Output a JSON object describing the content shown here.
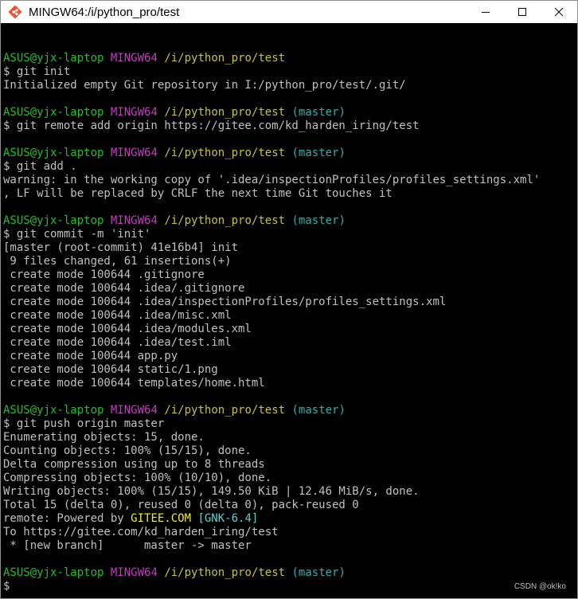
{
  "window": {
    "title": "MINGW64:/i/python_pro/test",
    "controls": [
      "minimize",
      "maximize",
      "close"
    ]
  },
  "prompt": {
    "user": "ASUS@yjx-laptop",
    "host": "MINGW64",
    "path": "/i/python_pro/test",
    "branch": "(master)"
  },
  "blocks": [
    {
      "has_branch": false,
      "command": "$ git init",
      "output": [
        "Initialized empty Git repository in I:/python_pro/test/.git/"
      ]
    },
    {
      "has_branch": true,
      "command": "$ git remote add origin https://gitee.com/kd_harden_iring/test",
      "output": []
    },
    {
      "has_branch": true,
      "command": "$ git add .",
      "output": [
        "warning: in the working copy of '.idea/inspectionProfiles/profiles_settings.xml'",
        ", LF will be replaced by CRLF the next time Git touches it"
      ]
    },
    {
      "has_branch": true,
      "command": "$ git commit -m 'init'",
      "output": [
        "[master (root-commit) 41e16b4] init",
        " 9 files changed, 61 insertions(+)",
        " create mode 100644 .gitignore",
        " create mode 100644 .idea/.gitignore",
        " create mode 100644 .idea/inspectionProfiles/profiles_settings.xml",
        " create mode 100644 .idea/misc.xml",
        " create mode 100644 .idea/modules.xml",
        " create mode 100644 .idea/test.iml",
        " create mode 100644 app.py",
        " create mode 100644 static/1.png",
        " create mode 100644 templates/home.html"
      ]
    },
    {
      "has_branch": true,
      "command": "$ git push origin master",
      "output": [
        "Enumerating objects: 15, done.",
        "Counting objects: 100% (15/15), done.",
        "Delta compression using up to 8 threads",
        "Compressing objects: 100% (10/10), done.",
        "Writing objects: 100% (15/15), 149.50 KiB | 12.46 MiB/s, done.",
        "Total 15 (delta 0), reused 0 (delta 0), pack-reused 0",
        {
          "parts": [
            {
              "text": "remote: Powered by ",
              "color": "default"
            },
            {
              "text": "GITEE.COM",
              "color": "yellow"
            },
            {
              "text": " ",
              "color": "default"
            },
            {
              "text": "[GNK-6.4]",
              "color": "cyan"
            }
          ]
        },
        "To https://gitee.com/kd_harden_iring/test",
        " * [new branch]      master -> master"
      ]
    },
    {
      "has_branch": true,
      "command": "$",
      "output": []
    }
  ],
  "watermark": "CSDN @ok!ko",
  "colors": {
    "background": "#000000",
    "text": "#c0c0c0",
    "user": "#1dc121",
    "host": "#c839c5",
    "path": "#c7c42d",
    "branch": "#2aaea8"
  }
}
